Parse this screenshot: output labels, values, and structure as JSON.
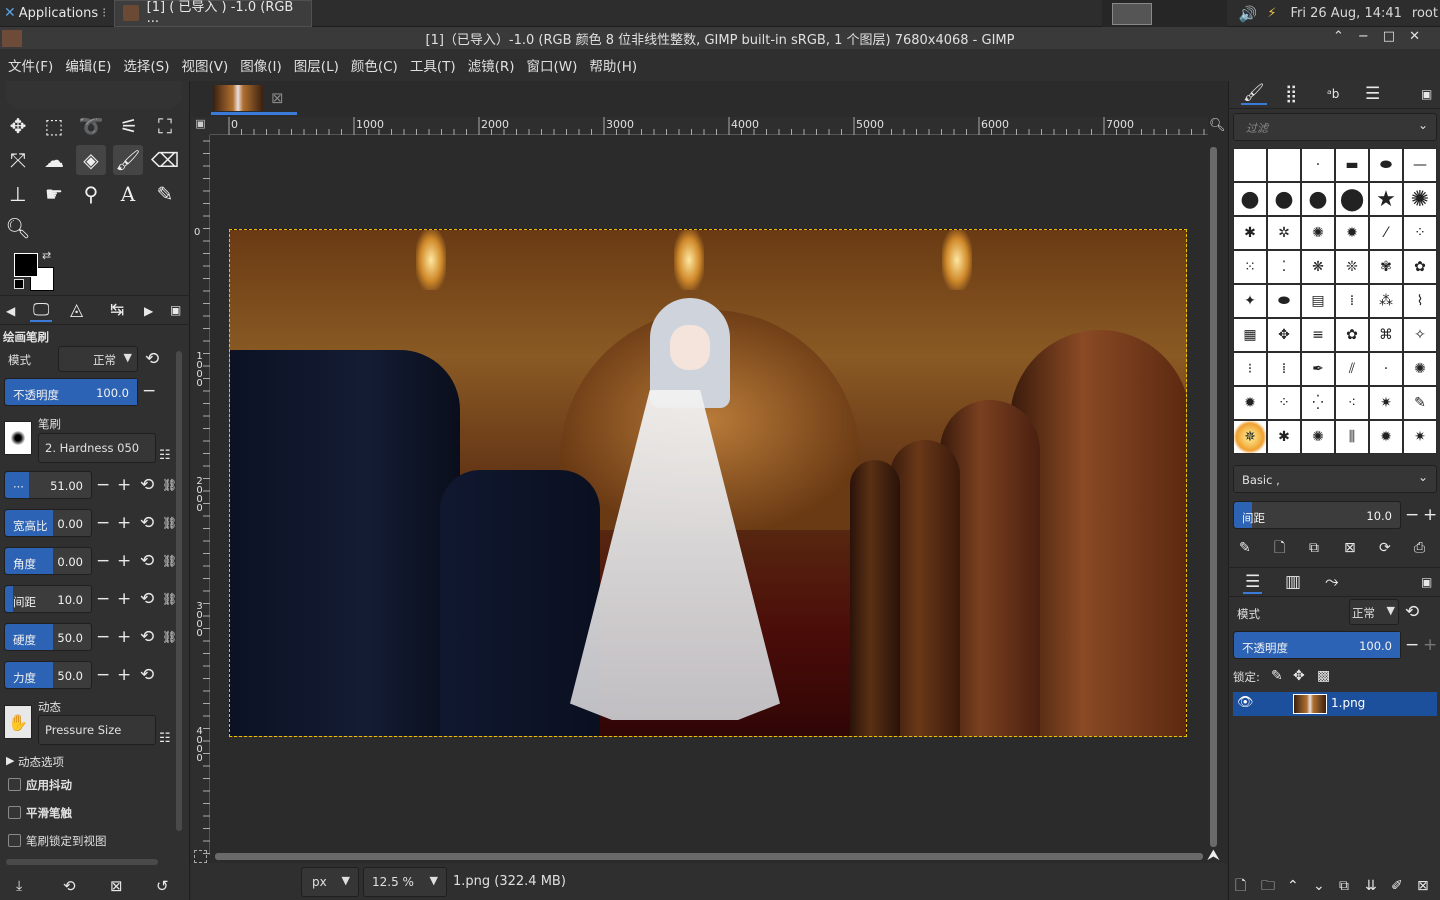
{
  "taskbar": {
    "apps_label": "Applications",
    "task_label": "[1] ( 已导入 ) -1.0 (RGB ···",
    "clock": "Fri 26 Aug, 14:41",
    "user": "root"
  },
  "window": {
    "title": "[1]（已导入）-1.0 (RGB 颜色 8 位非线性整数, GIMP built-in sRGB, 1 个图层) 7680x4068 - GIMP"
  },
  "menu": [
    "文件(F)",
    "编辑(E)",
    "选择(S)",
    "视图(V)",
    "图像(I)",
    "图层(L)",
    "颜色(C)",
    "工具(T)",
    "滤镜(R)",
    "窗口(W)",
    "帮助(H)"
  ],
  "tool_options": {
    "title": "绘画笔刷",
    "mode_label": "模式",
    "mode_value": "正常",
    "opacity_label": "不透明度",
    "opacity_value": "100.0",
    "opacity_fill": 1.0,
    "brush_label": "笔刷",
    "brush_name": "2. Hardness 050",
    "size_label": "···",
    "size_value": "51.00",
    "aspect_label": "宽高比",
    "aspect_value": "0.00",
    "angle_label": "角度",
    "angle_value": "0.00",
    "spacing_label": "间距",
    "spacing_value": "10.0",
    "hardness_label": "硬度",
    "hardness_value": "50.0",
    "force_label": "力度",
    "force_value": "50.0",
    "dynamics_label": "动态",
    "dynamics_value": "Pressure Size",
    "dynamics_options": "动态选项",
    "apply_jitter": "应用抖动",
    "smooth_stroke": "平滑笔触",
    "lock_brush": "笔刷锁定到视图"
  },
  "ruler": {
    "h_ticks": [
      "0",
      "1000",
      "2000",
      "3000",
      "4000",
      "5000",
      "6000",
      "7000"
    ],
    "v_ticks": [
      "0",
      "1000",
      "2000",
      "3000",
      "4000"
    ]
  },
  "status": {
    "unit": "px",
    "zoom": "12.5 %",
    "file_info": "1.png (322.4 MB)"
  },
  "brushes_panel": {
    "filter_placeholder": "过滤",
    "preset": "Basic ,",
    "spacing_label": "间距",
    "spacing_value": "10.0"
  },
  "layers_panel": {
    "mode_label": "模式",
    "mode_value": "正常",
    "opacity_label": "不透明度",
    "opacity_value": "100.0",
    "lock_label": "锁定:",
    "layer_name": "1.png"
  },
  "colors": {
    "accent": "#2d63b4",
    "selected_layer": "#1c4f9c"
  }
}
